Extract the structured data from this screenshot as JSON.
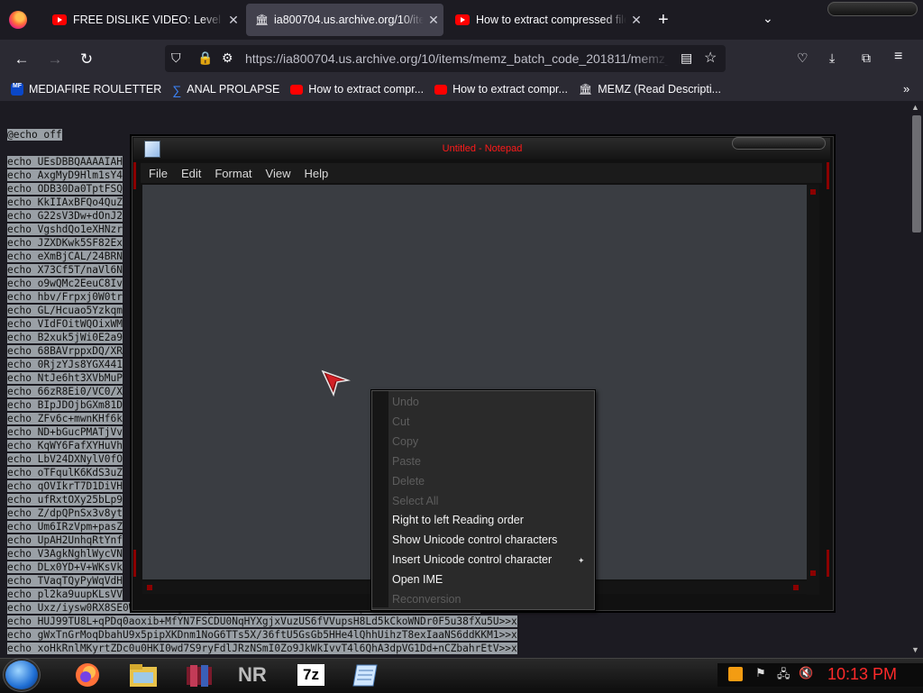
{
  "browser": {
    "tabs": [
      {
        "title": "FREE DISLIKE VIDEO: Level Fail C",
        "icon": "youtube-icon",
        "active": false
      },
      {
        "title": "ia800704.us.archive.org/10/item",
        "icon": "archive-icon",
        "active": true
      },
      {
        "title": "How to extract compressed file",
        "icon": "youtube-icon",
        "active": false
      }
    ],
    "url": "https://ia800704.us.archive.org/10/items/memz_batch_code_201811/memz_l",
    "bookmarks": [
      {
        "label": "MEDIAFIRE ROULETTER",
        "icon": "mediafire-icon"
      },
      {
        "label": "ANAL PROLAPSE",
        "icon": "sigma-icon"
      },
      {
        "label": "How to extract compr...",
        "icon": "youtube-icon"
      },
      {
        "label": "How to extract compr...",
        "icon": "youtube-icon"
      },
      {
        "label": "MEMZ (Read Descripti...",
        "icon": "archive-icon"
      }
    ]
  },
  "page": {
    "first_line": "@echo off",
    "lines": [
      "echo UEsDBBQAAAAIAH",
      "echo AxgMyD9Hlm1sY4",
      "echo ODB30Da0TptFSQ",
      "echo KkIIAxBFQo4QuZ",
      "echo G22sV3Dw+dOnJ2",
      "echo VgshdQo1eXHNzr",
      "echo JZXDKwk5SF82Ex",
      "echo eXmBjCAL/24BRN",
      "echo X73Cf5T/naVl6N",
      "echo o9wQMc2EeuC8Iv",
      "echo hbv/Frpxj0W0tr",
      "echo GL/Hcuao5Yzkqm",
      "echo VIdFOitWQOixWM",
      "echo B2xuk5jWi0E2a9",
      "echo 68BAVrppxDQ/XR",
      "echo 0RjzYJs8YGX441",
      "echo NtJe6ht3XVbMuP",
      "echo 66zR8Ei0/VC0/X",
      "echo BIpJDOjbGXm81D",
      "echo ZFv6c+mwnKHf6k",
      "echo ND+bGucPMATjVv",
      "echo KqWY6FafXYHuVh",
      "echo LbV24DXNylV0fO",
      "echo oTFqulK6KdS3uZ",
      "echo qOVIkrT7D1DiVH",
      "echo ufRxtOXy25bLp9",
      "echo Z/dpQPnSx3v8yt",
      "echo Um6IRzVpm+pasZ",
      "echo UpAH2UnhqRtYnf",
      "echo V3AgkNghlWycVN",
      "echo DLx0YD+V+WKsVk",
      "echo TVaqTQyPyWqVdH",
      "echo pl2ka9uupKLsVV",
      "echo Uxz/iysw0RX8SE0WmMuBdetgaMnlyT2618eGhdr3xD1I7E3TsRtGxymH1JnUQhndKHUlUn>>x",
      "echo HUJ99TU8L+qPDq0aoxib+MfYN7FSCDU0NqHYXgjxVuzUS6fVVupsH8Ld5kCkoWNDr0F5u38fXu5U>>x",
      "echo gWxTnGrMoqDbahU9x5pipXKDnm1NoG6TTs5X/36ftU5GsGb5HHe4lQhhUihzT8exIaaNS6ddKKM1>>x",
      "echo xoHkRnlMKyrtZDc0u0HKI0wd7S9ryFdlJRzNSmI0Zo9JkWkIvvT4l6QhA3dpVG1Dd+nCZbahrEtV>>x"
    ]
  },
  "notepad": {
    "title": "Untitled - Notepad",
    "menu": [
      "File",
      "Edit",
      "Format",
      "View",
      "Help"
    ],
    "context_menu": [
      {
        "label": "Undo",
        "enabled": false
      },
      {
        "label": "Cut",
        "enabled": false
      },
      {
        "label": "Copy",
        "enabled": false
      },
      {
        "label": "Paste",
        "enabled": false
      },
      {
        "label": "Delete",
        "enabled": false
      },
      {
        "label": "Select All",
        "enabled": false
      },
      {
        "label": "Right to left Reading order",
        "enabled": true
      },
      {
        "label": "Show Unicode control characters",
        "enabled": true
      },
      {
        "label": "Insert Unicode control character",
        "enabled": true,
        "submenu": true
      },
      {
        "label": "Open IME",
        "enabled": true
      },
      {
        "label": "Reconversion",
        "enabled": false
      }
    ]
  },
  "taskbar": {
    "items": [
      "firefox-icon",
      "file-explorer-icon",
      "winrar-icon",
      "nr-icon",
      "7zip-icon",
      "notepad-icon"
    ],
    "nr_label": "NR",
    "zip_label": "7z",
    "clock": "10:13 PM"
  },
  "colors": {
    "accent_red": "#ff1a1a",
    "selection": "#9aa0a6"
  }
}
